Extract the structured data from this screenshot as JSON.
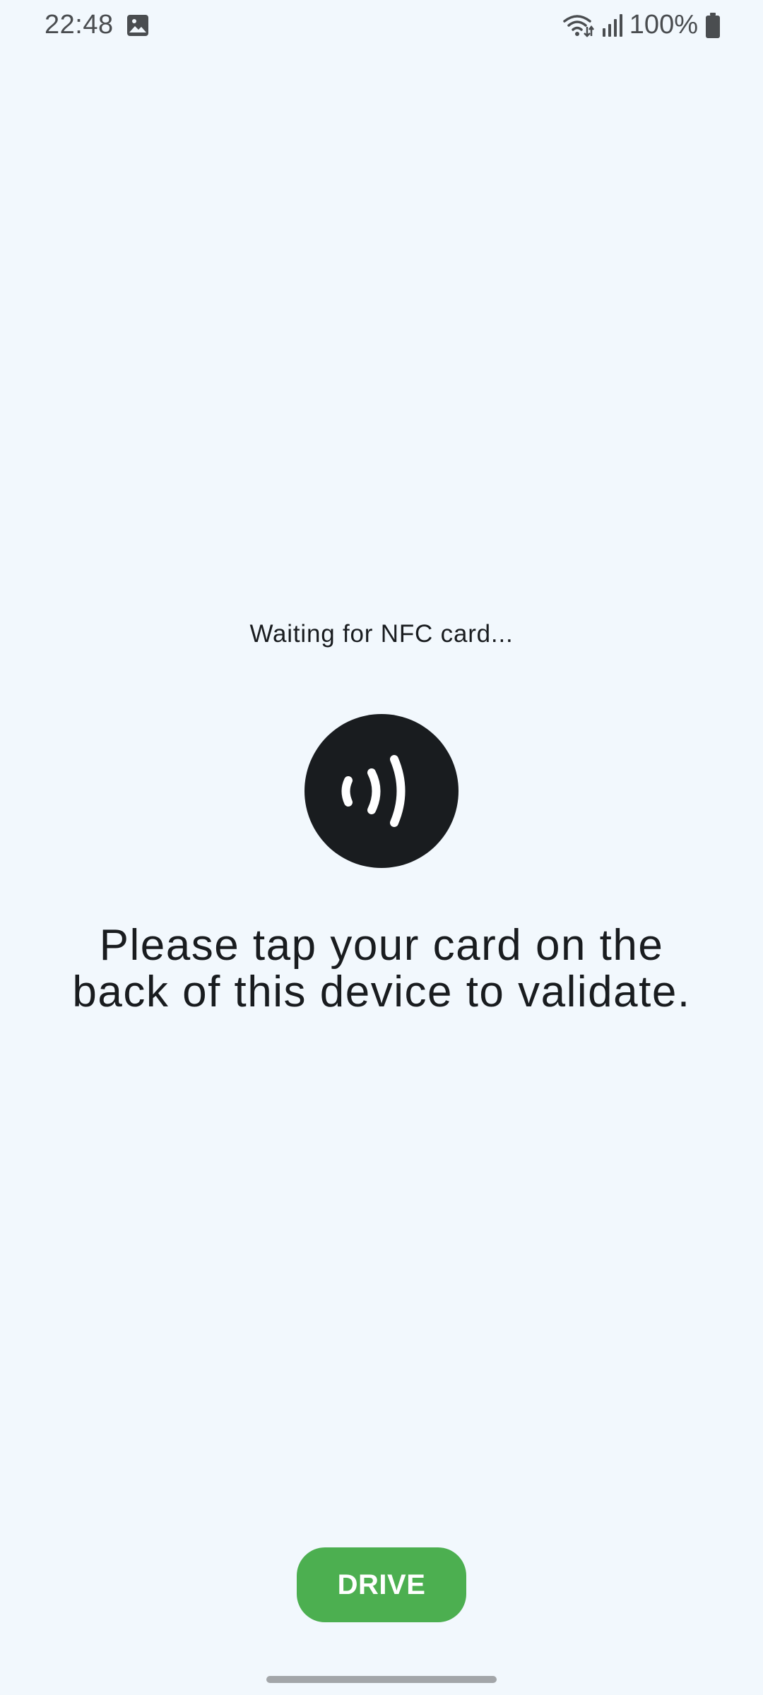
{
  "status_bar": {
    "time": "22:48",
    "battery_percent": "100%",
    "icons": [
      "gallery-icon",
      "wifi-icon",
      "signal-icon",
      "battery-icon"
    ]
  },
  "main": {
    "waiting_text": "Waiting for NFC card...",
    "nfc_icon": "nfc-contactless-icon",
    "instruction_line1": "Please tap your card on the",
    "instruction_line2": "back of this device to validate."
  },
  "actions": {
    "drive_label": "DRIVE"
  },
  "colors": {
    "background": "#f2f8fd",
    "text": "#191c1f",
    "button": "#4caf50",
    "button_text": "#ffffff"
  }
}
